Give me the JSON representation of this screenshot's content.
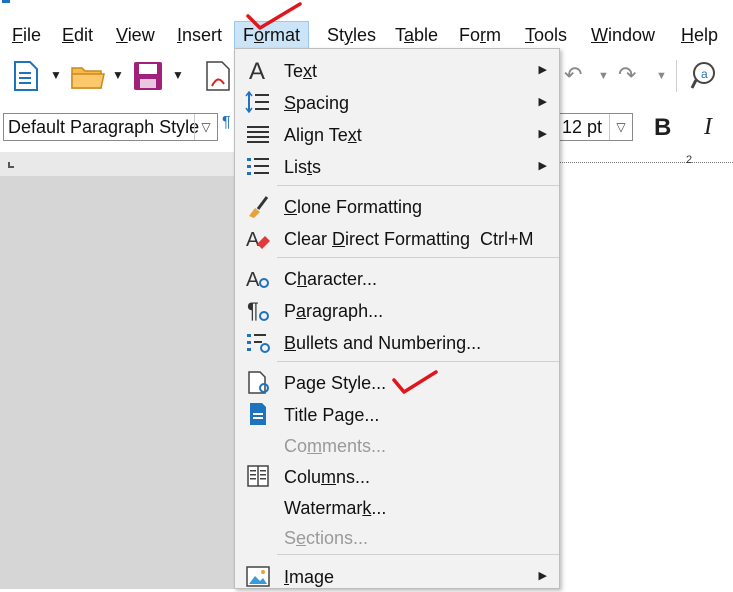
{
  "menubar": {
    "items": [
      {
        "label": "File",
        "accel": "F",
        "rest": "ile"
      },
      {
        "label": "Edit",
        "accel": "E",
        "rest": "dit"
      },
      {
        "label": "View",
        "accel": "V",
        "rest": "iew"
      },
      {
        "label": "Insert",
        "accel": "I",
        "rest": "nsert"
      },
      {
        "label": "Format",
        "accel": "o",
        "pre": "F",
        "rest": "rmat"
      },
      {
        "label": "Styles",
        "accel": "y",
        "pre": "St",
        "rest": "les"
      },
      {
        "label": "Table",
        "accel": "a",
        "pre": "T",
        "rest": "ble"
      },
      {
        "label": "Form",
        "accel": "r",
        "pre": "Fo",
        "rest": "m"
      },
      {
        "label": "Tools",
        "accel": "T",
        "rest": "ools"
      },
      {
        "label": "Window",
        "accel": "W",
        "rest": "indow"
      },
      {
        "label": "Help",
        "accel": "H",
        "rest": "elp"
      }
    ]
  },
  "toolbar": {
    "paragraph_style": "Default Paragraph Style",
    "font_size": "12 pt",
    "bold_label": "B",
    "italic_label": "I"
  },
  "format_menu": {
    "items": [
      {
        "label": "Text",
        "pre": "Te",
        "accel": "x",
        "rest": "t",
        "icon": "text-a-icon",
        "submenu": true
      },
      {
        "label": "Spacing",
        "pre": "",
        "accel": "S",
        "rest": "pacing",
        "icon": "line-spacing-icon",
        "submenu": true
      },
      {
        "label": "Align Text",
        "pre": "Align Te",
        "accel": "x",
        "rest": "t",
        "icon": "align-justify-icon",
        "submenu": true
      },
      {
        "label": "Lists",
        "pre": "Lis",
        "accel": "t",
        "rest": "s",
        "icon": "bulleted-list-icon",
        "submenu": true
      },
      {
        "label": "Clone Formatting",
        "pre": "",
        "accel": "C",
        "rest": "lone Formatting",
        "icon": "paintbrush-icon"
      },
      {
        "label": "Clear Direct Formatting",
        "pre": "Clear ",
        "accel": "D",
        "rest": "irect Formatting",
        "shortcut": "Ctrl+M",
        "icon": "clear-formatting-icon"
      },
      {
        "label": "Character...",
        "pre": "C",
        "accel": "h",
        "rest": "aracter...",
        "icon": "character-settings-icon"
      },
      {
        "label": "Paragraph...",
        "pre": "P",
        "accel": "a",
        "rest": "ragraph...",
        "icon": "paragraph-settings-icon"
      },
      {
        "label": "Bullets and Numbering...",
        "pre": "",
        "accel": "B",
        "rest": "ullets and Numbering...",
        "icon": "bullets-numbering-icon"
      },
      {
        "label": "Page Style...",
        "pre": "Pa",
        "accel": "g",
        "rest": "e Style...",
        "icon": "page-style-icon"
      },
      {
        "label": "Title Page...",
        "pre": "Title Pa",
        "accel": "g",
        "rest": "e...",
        "icon": "title-page-icon"
      },
      {
        "label": "Comments...",
        "pre": "Co",
        "accel": "m",
        "rest": "ments...",
        "icon": "",
        "disabled": true
      },
      {
        "label": "Columns...",
        "pre": "Colu",
        "accel": "m",
        "rest": "ns...",
        "icon": "columns-icon"
      },
      {
        "label": "Watermark...",
        "pre": "Watermar",
        "accel": "k",
        "rest": "...",
        "icon": ""
      },
      {
        "label": "Sections...",
        "pre": "S",
        "accel": "e",
        "rest": "ctions...",
        "icon": "",
        "disabled": true
      },
      {
        "label": "Image",
        "pre": "",
        "accel": "I",
        "rest": "mage",
        "icon": "image-icon",
        "submenu": true
      }
    ]
  },
  "ruler": {
    "mark": "2"
  },
  "colors": {
    "accent": "#1e73be",
    "annotation": "#e0161c",
    "menu_bg": "#f2f2f2",
    "highlight": "#cce4f7"
  }
}
